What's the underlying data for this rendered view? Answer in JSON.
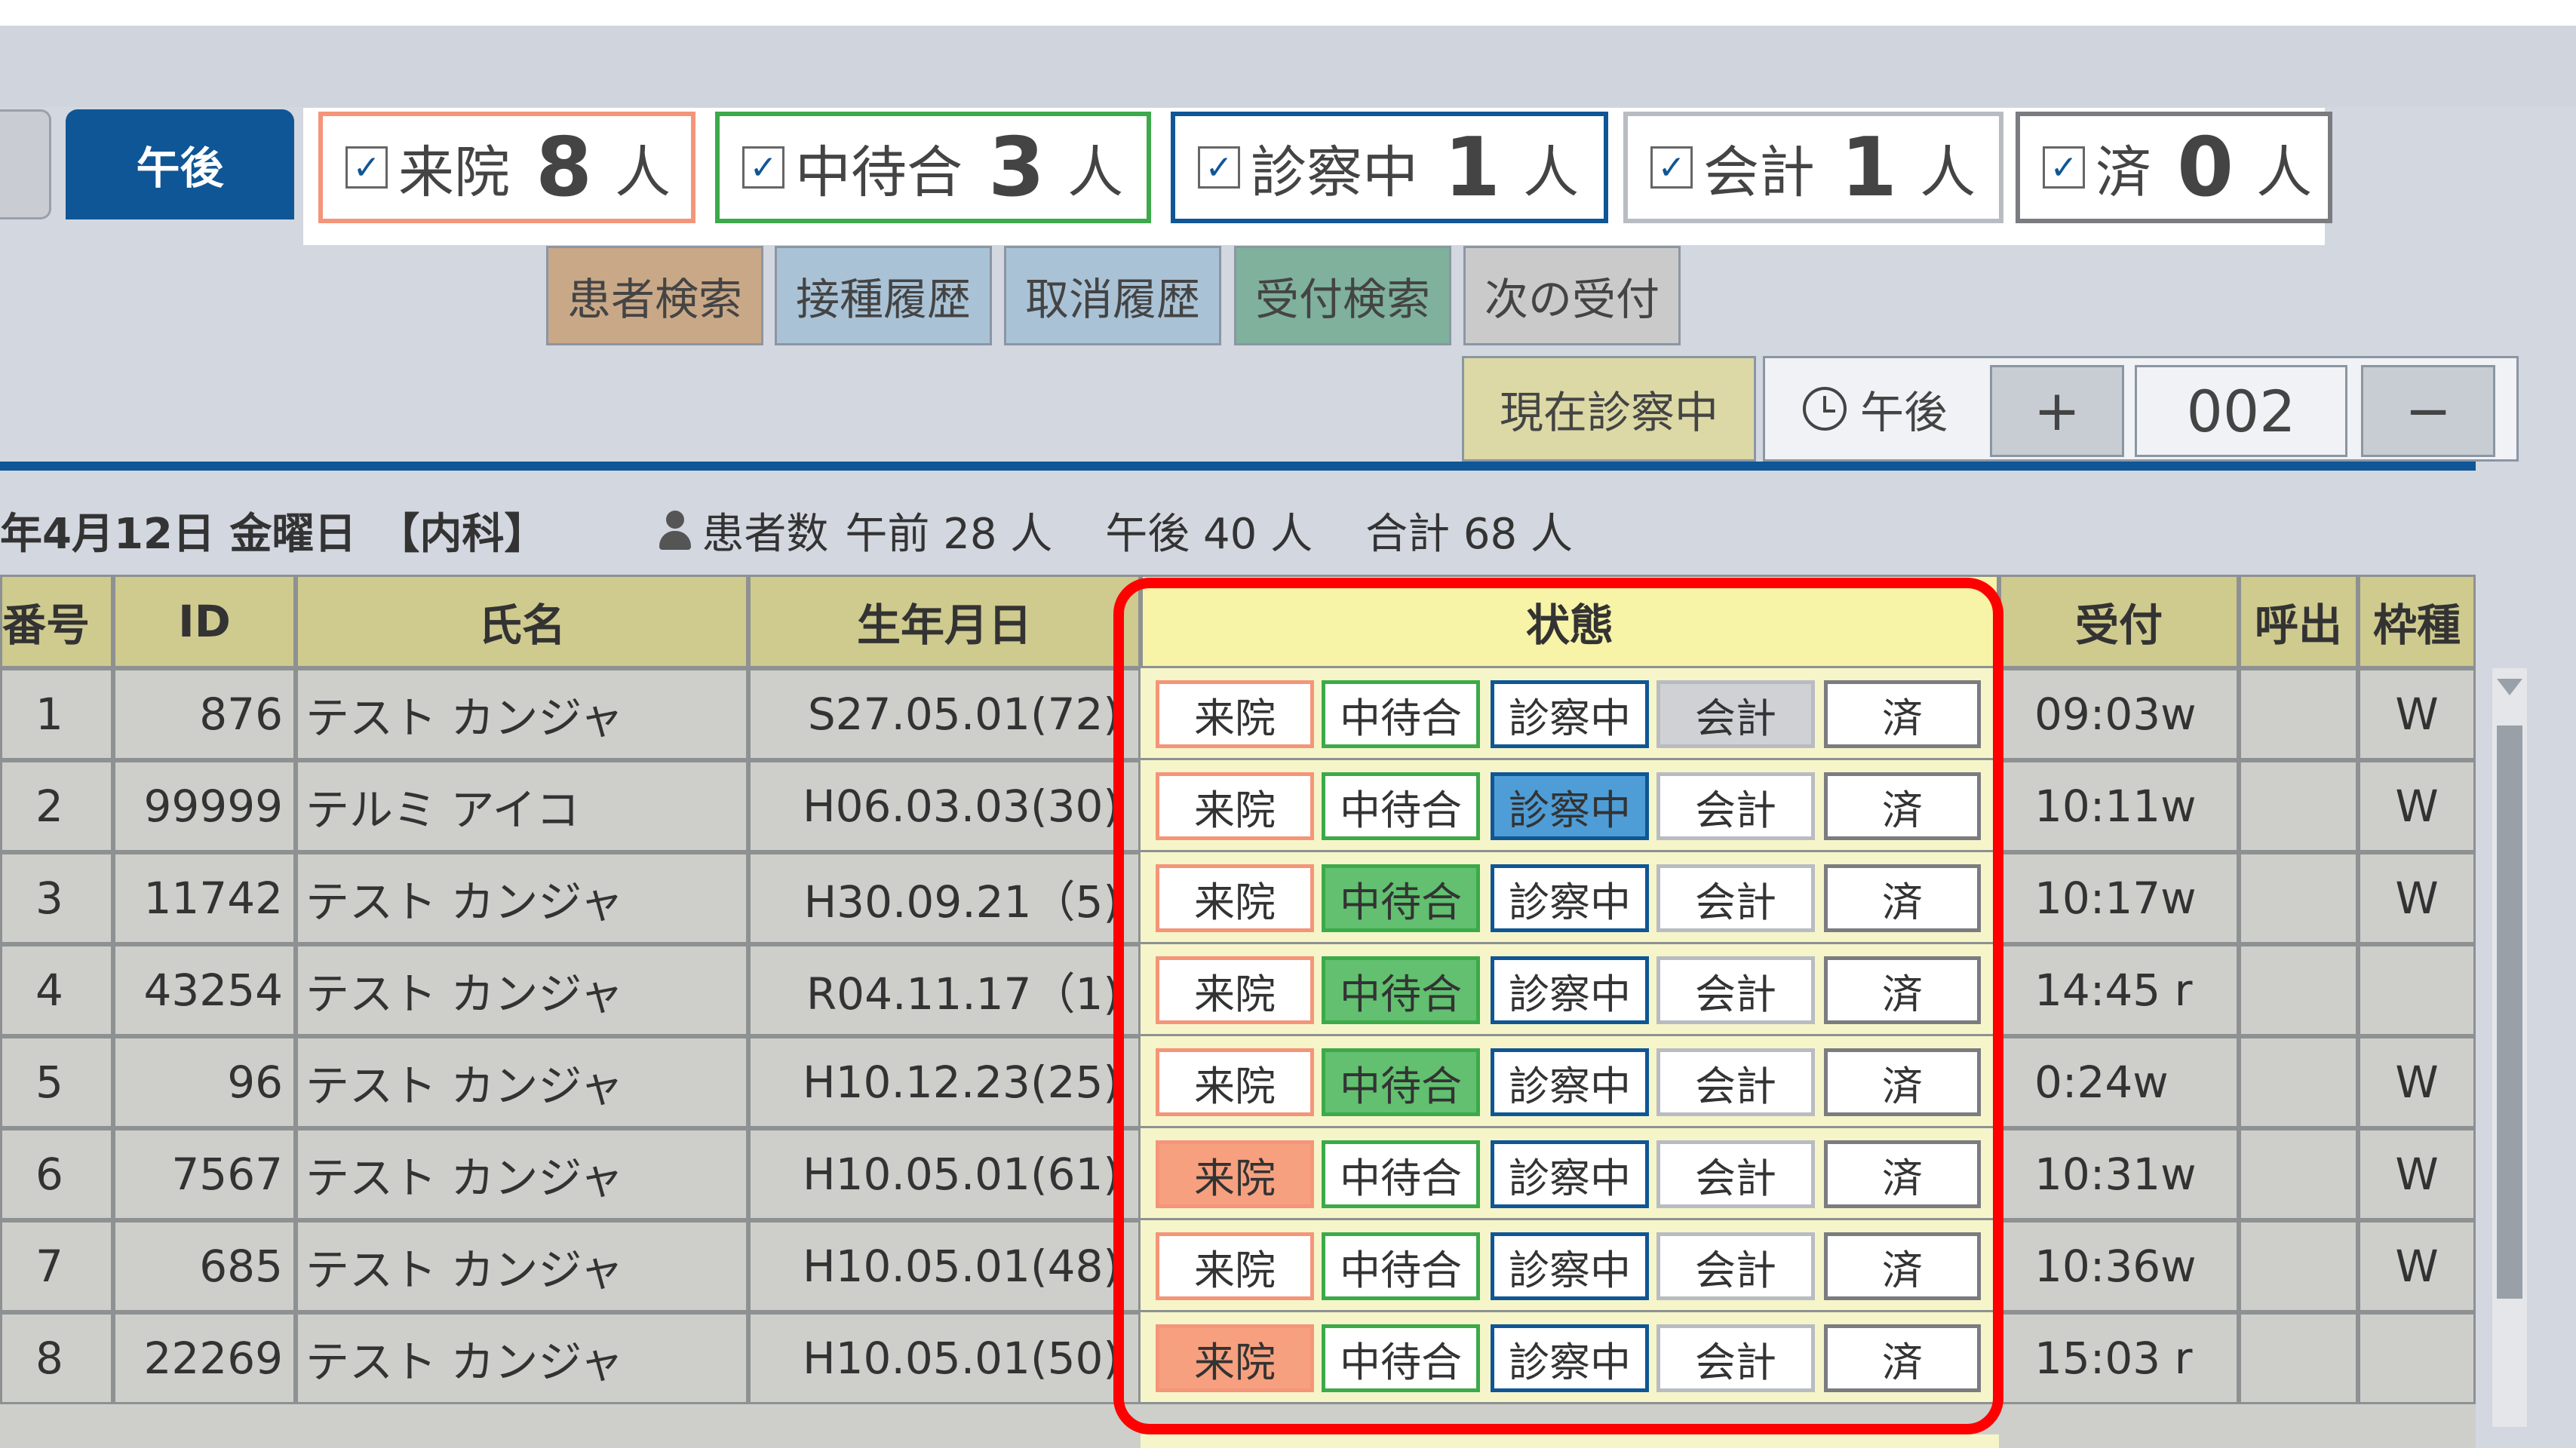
{
  "tabs": {
    "afternoon_label": "午後"
  },
  "counters": [
    {
      "label": "来院",
      "count": "8",
      "unit": "人",
      "color": "#f4957a"
    },
    {
      "label": "中待合",
      "count": "3",
      "unit": "人",
      "color": "#3caa4a"
    },
    {
      "label": "診察中",
      "count": "1",
      "unit": "人",
      "color": "#0f5696"
    },
    {
      "label": "会計",
      "count": "1",
      "unit": "人",
      "color": "#b8bcc2"
    },
    {
      "label": "済",
      "count": "0",
      "unit": "人",
      "color": "#7a7c80"
    }
  ],
  "checkbox_mark": "✓",
  "actions": [
    {
      "label": "患者検索",
      "bg": "#c9a888"
    },
    {
      "label": "接種履歴",
      "bg": "#a9c2d6"
    },
    {
      "label": "取消履歴",
      "bg": "#a9c2d6"
    },
    {
      "label": "受付検索",
      "bg": "#7fb19c"
    },
    {
      "label": "次の受付",
      "bg": "#cacaca"
    }
  ],
  "current_exam_label": "現在診察中",
  "clock": {
    "label": "午後",
    "icon": "clock-icon"
  },
  "stepper": {
    "plus": "+",
    "value": "002",
    "minus": "−"
  },
  "info": {
    "date": "年4月12日 金曜日　【内科】",
    "patients_label": "患者数",
    "morning": "午前 28 人",
    "afternoon": "午後 40 人",
    "total": "合計 68 人",
    "icon": "person-icon"
  },
  "columns": [
    "番号",
    "ID",
    "氏名",
    "生年月日",
    "状態",
    "受付",
    "呼出",
    "枠種"
  ],
  "state_labels": [
    "来院",
    "中待合",
    "診察中",
    "会計",
    "済"
  ],
  "state_colors": {
    "raiin": "#f4957a",
    "nakamachi": "#3caa4a",
    "shinsatsu": "#0f5696",
    "kaikei": "#b8bcc2",
    "sumi": "#7a7c80",
    "raiin_fill": "#f7a07f",
    "nakamachi_fill": "#62c070",
    "shinsatsu_fill": "#4f9dd6",
    "kaikei_fill": "#d0d1d4"
  },
  "rows": [
    {
      "no": "1",
      "id": "876",
      "name": "テスト カンジャ",
      "dob": "S27.05.01(72)",
      "reception": "09:03w",
      "call": "",
      "frame": "W",
      "active": 3
    },
    {
      "no": "2",
      "id": "99999",
      "name": "テルミ アイコ",
      "dob": "H06.03.03(30)",
      "reception": "10:11w",
      "call": "",
      "frame": "W",
      "active": 2
    },
    {
      "no": "3",
      "id": "11742",
      "name": "テスト カンジャ",
      "dob": "H30.09.21（5)",
      "reception": "10:17w",
      "call": "",
      "frame": "W",
      "active": 1
    },
    {
      "no": "4",
      "id": "43254",
      "name": "テスト カンジャ",
      "dob": "R04.11.17（1)",
      "reception": "14:45 r",
      "call": "",
      "frame": "",
      "active": 1
    },
    {
      "no": "5",
      "id": "96",
      "name": "テスト カンジャ",
      "dob": "H10.12.23(25)",
      "reception": "0:24w",
      "call": "",
      "frame": "W",
      "active": 1
    },
    {
      "no": "6",
      "id": "7567",
      "name": "テスト カンジャ",
      "dob": "H10.05.01(61)",
      "reception": "10:31w",
      "call": "",
      "frame": "W",
      "active": 0
    },
    {
      "no": "7",
      "id": "685",
      "name": "テスト カンジャ",
      "dob": "H10.05.01(48)",
      "reception": "10:36w",
      "call": "",
      "frame": "W",
      "active": -1
    },
    {
      "no": "8",
      "id": "22269",
      "name": "テスト カンジャ",
      "dob": "H10.05.01(50)",
      "reception": "15:03 r",
      "call": "",
      "frame": "",
      "active": 0
    }
  ]
}
